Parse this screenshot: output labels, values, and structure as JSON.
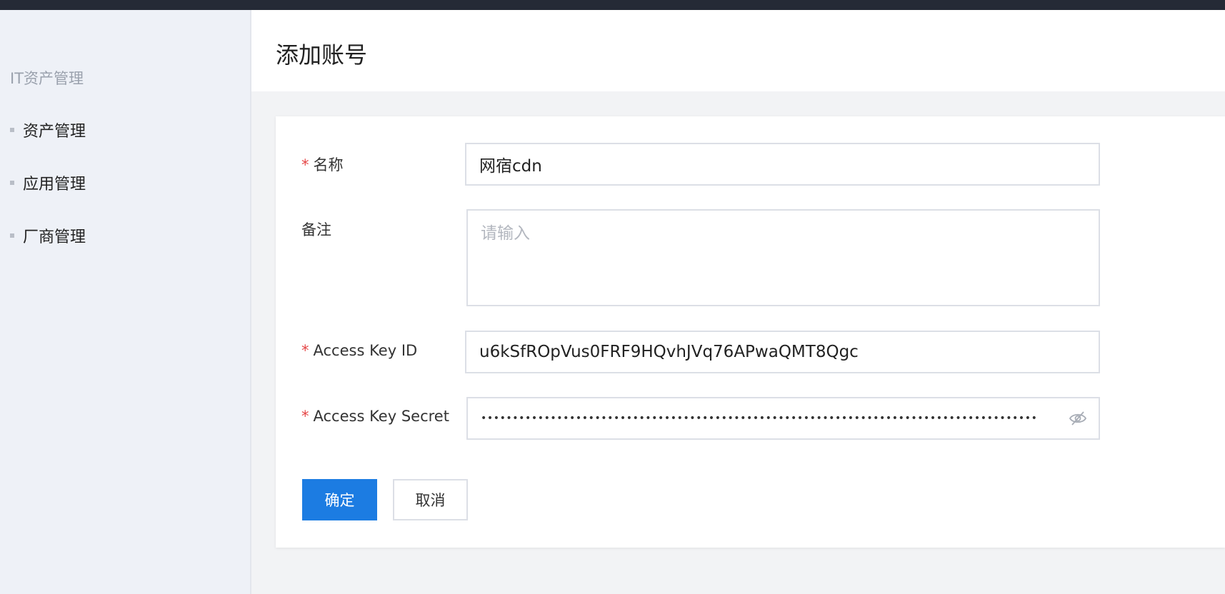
{
  "sidebar": {
    "title": "IT资产管理",
    "items": [
      {
        "label": "资产管理"
      },
      {
        "label": "应用管理"
      },
      {
        "label": "厂商管理"
      }
    ]
  },
  "header": {
    "title": "添加账号"
  },
  "form": {
    "name": {
      "label": "名称",
      "required_mark": "*",
      "value": "网宿cdn"
    },
    "remark": {
      "label": "备注",
      "placeholder": "请输入",
      "value": ""
    },
    "access_key_id": {
      "label": "Access Key ID",
      "required_mark": "*",
      "value": "u6kSfROpVus0FRF9HQvhJVq76APwaQMT8Qgc"
    },
    "access_key_secret": {
      "label": "Access Key Secret",
      "required_mark": "*",
      "masked_value": "••••••••••••••••••••••••••••••••••••••••••••••••••••••••••••••••••••••••••••••••••••••••",
      "toggle_icon": "eye-hidden-icon"
    }
  },
  "actions": {
    "confirm_label": "确定",
    "cancel_label": "取消"
  },
  "colors": {
    "primary": "#1c7ce2",
    "required": "#e54545",
    "topbar": "#252a36",
    "sidebar_bg": "#eef1f7"
  }
}
